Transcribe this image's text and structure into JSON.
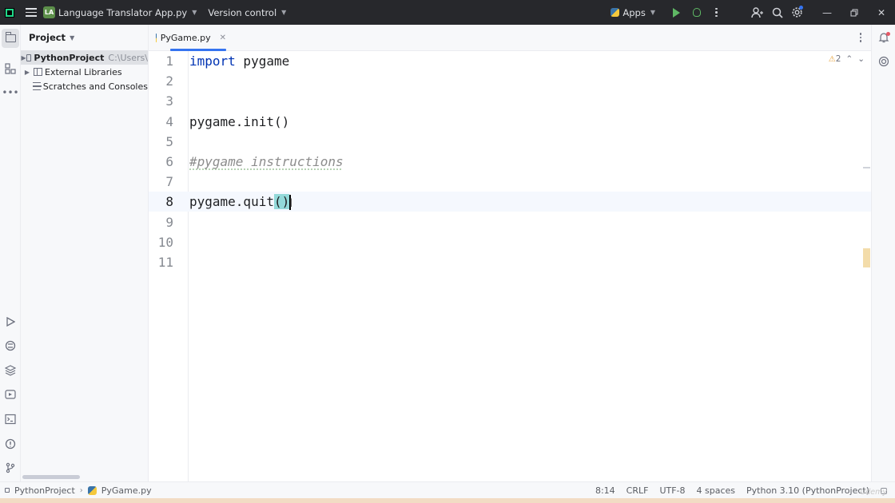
{
  "titlebar": {
    "project_badge": "LA",
    "project_name": "Language Translator App.py",
    "vcs_label": "Version control",
    "run_config": "Apps"
  },
  "project_panel": {
    "title": "Project",
    "tree": [
      {
        "label": "PythonProject",
        "hint": "C:\\Users\\",
        "expandable": true,
        "selected": true,
        "icon": "folder-icon"
      },
      {
        "label": "External Libraries",
        "expandable": true,
        "selected": false,
        "icon": "library-icon"
      },
      {
        "label": "Scratches and Consoles",
        "expandable": false,
        "selected": false,
        "icon": "scratches-icon"
      }
    ]
  },
  "editor": {
    "active_tab": "PyGame.py",
    "inspection_warnings": "2",
    "line_numbers": [
      "1",
      "2",
      "3",
      "4",
      "5",
      "6",
      "7",
      "8",
      "9",
      "10",
      "11"
    ],
    "current_line": 8,
    "code": {
      "l1_kw": "import",
      "l1_rest": " pygame",
      "l4": "pygame.init()",
      "l6": "#pygame instructions",
      "l8_pre": "pygame.quit",
      "l8_paren": "()"
    }
  },
  "statusbar": {
    "breadcrumb_root": "PythonProject",
    "breadcrumb_file": "PyGame.py",
    "position": "8:14",
    "line_ending": "CRLF",
    "encoding": "UTF-8",
    "indent": "4 spaces",
    "interpreter": "Python 3.10 (PythonProject)",
    "watermark": "Udemy"
  },
  "colors": {
    "keyword": "#0033b3",
    "comment": "#8c8c8c",
    "tab_accent": "#3574f0",
    "brace_highlight": "#93d9d9",
    "titlebar": "#27282c"
  }
}
